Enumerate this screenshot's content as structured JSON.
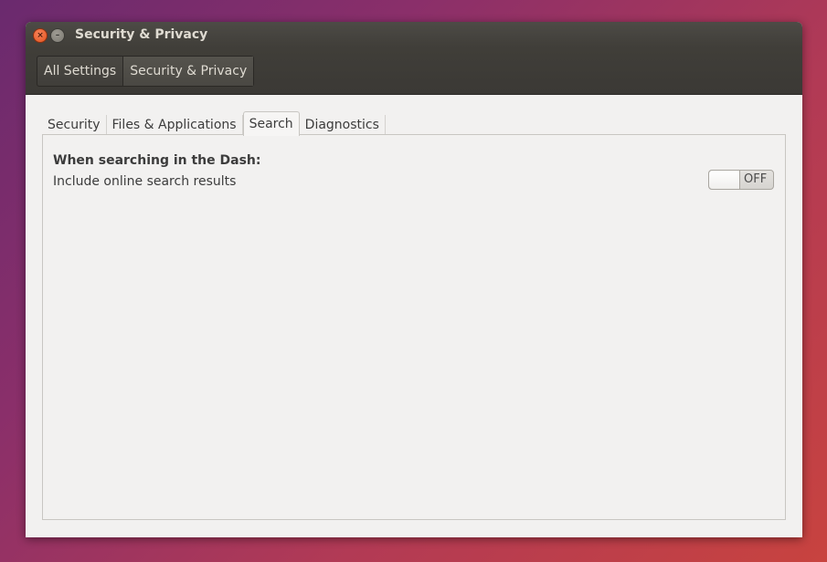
{
  "window": {
    "title": "Security & Privacy",
    "close_glyph": "×",
    "minimize_glyph": "–"
  },
  "breadcrumb": {
    "items": [
      {
        "label": "All Settings"
      },
      {
        "label": "Security & Privacy"
      }
    ]
  },
  "tabs": [
    {
      "label": "Security"
    },
    {
      "label": "Files & Applications"
    },
    {
      "label": "Search"
    },
    {
      "label": "Diagnostics"
    }
  ],
  "search_tab": {
    "heading": "When searching in the Dash:",
    "option_label": "Include online search results",
    "toggle_state": "OFF"
  },
  "colors": {
    "close_button": "#e3541e",
    "titlebar": "#403e39",
    "window_bg": "#f2f1f0"
  }
}
